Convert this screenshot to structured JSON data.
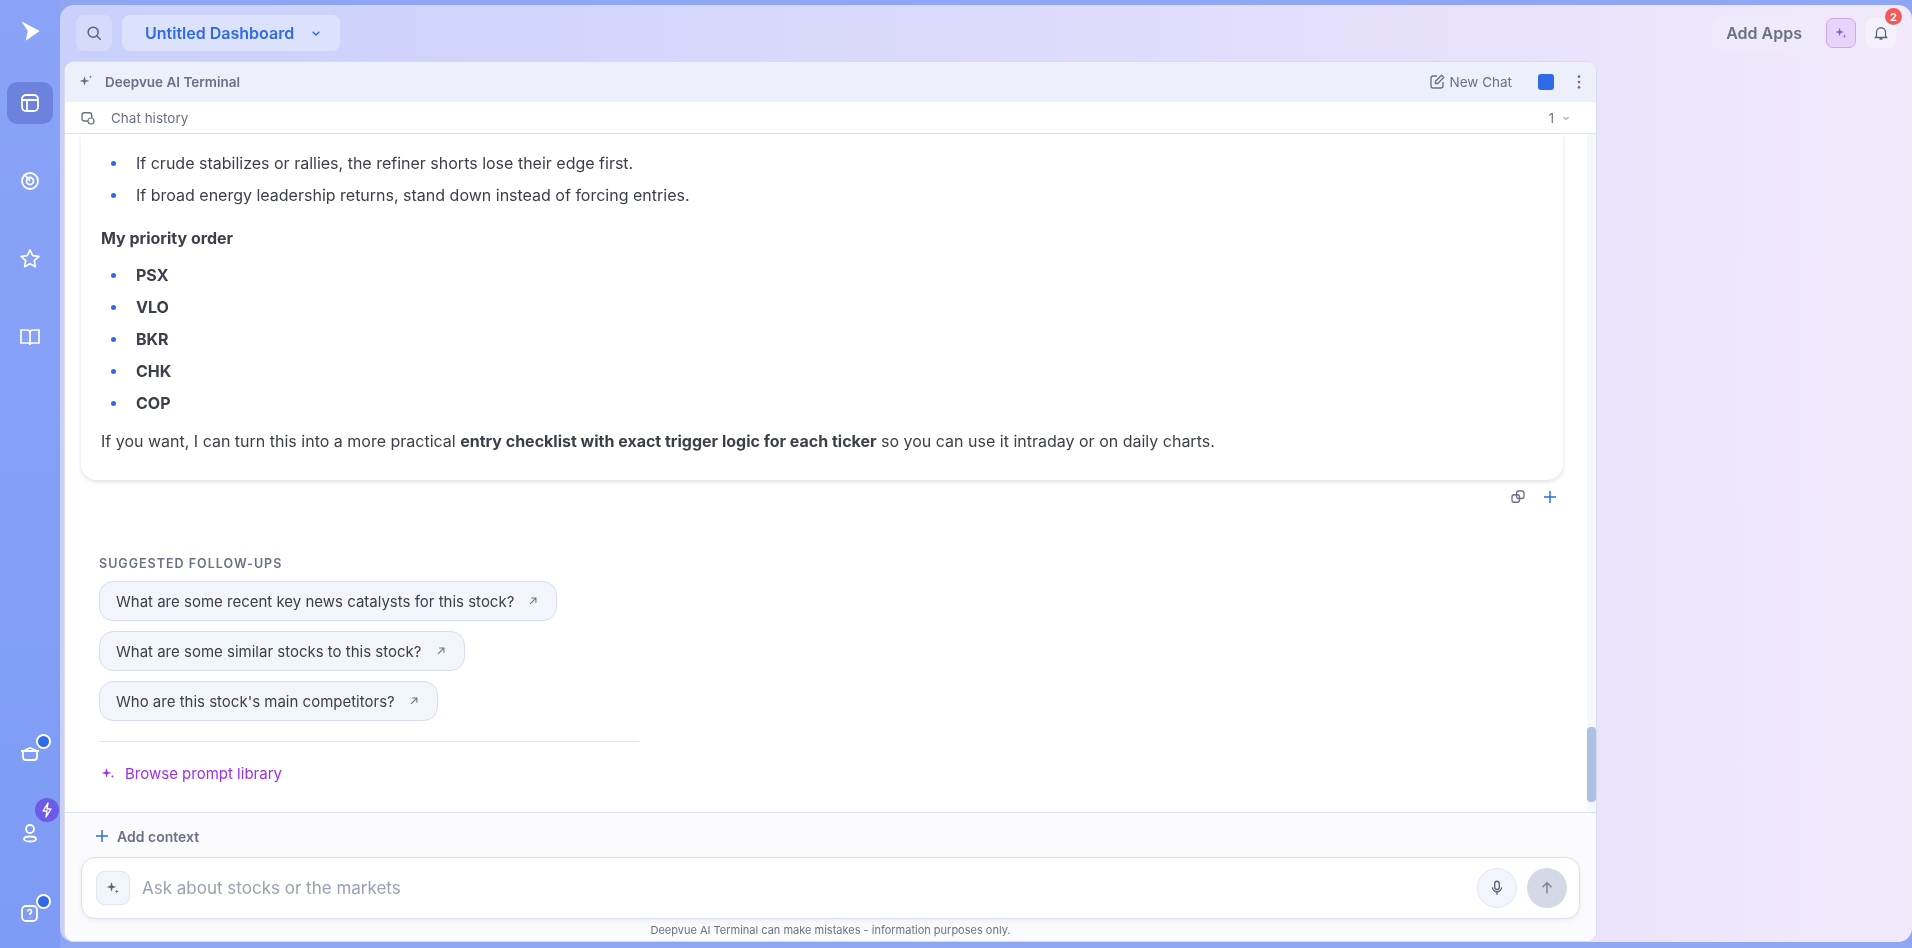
{
  "sidebar": {
    "top_items": [
      {
        "kind": "dashboard",
        "selected": true
      },
      {
        "kind": "radar",
        "selected": false
      },
      {
        "kind": "star",
        "selected": false
      },
      {
        "kind": "book",
        "selected": false
      }
    ],
    "bottom_items": [
      {
        "kind": "learn",
        "dot": true
      },
      {
        "kind": "profile",
        "dot": false
      },
      {
        "kind": "help",
        "dot": true
      }
    ]
  },
  "topbar": {
    "dashboard_title": "Untitled Dashboard",
    "add_apps": "Add Apps",
    "notification_count": "2"
  },
  "terminal": {
    "title": "Deepvue AI Terminal",
    "new_chat": "New Chat",
    "chat_history": "Chat history",
    "history_count": "1"
  },
  "message": {
    "bullets": [
      "If crude stabilizes or rallies, the refiner shorts lose their edge first.",
      "If broad energy leadership returns, stand down instead of forcing entries."
    ],
    "heading": "My priority order",
    "tickers": [
      "PSX",
      "VLO",
      "BKR",
      "CHK",
      "COP"
    ],
    "closing": "If you want, I can turn this into a more practical **entry checklist with exact trigger logic for each ticker** so you can use it intraday or on daily charts."
  },
  "followups": {
    "heading": "SUGGESTED FOLLOW-UPS",
    "items": [
      "What are some recent key news catalysts for this stock?",
      "What are some similar stocks to this stock?",
      "Who are this stock's main competitors?"
    ],
    "browse": "Browse prompt library"
  },
  "composer": {
    "add_context": "Add context",
    "placeholder": "Ask about stocks or the markets",
    "disclaimer": "Deepvue AI Terminal can make mistakes - information purposes only."
  }
}
